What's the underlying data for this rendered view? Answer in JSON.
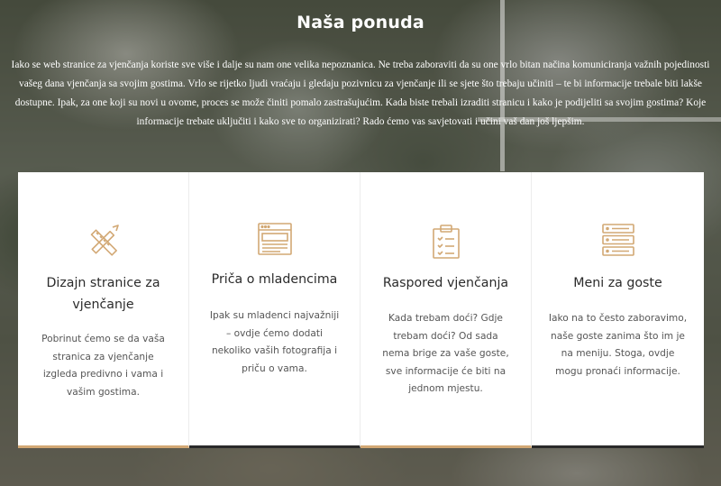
{
  "section": {
    "title": "Naša ponuda",
    "intro": "Iako se web stranice za vjenčanja koriste sve više i dalje su nam one velika nepoznanica. Ne treba zaboraviti da su one vrlo bitan načina komuniciranja važnih pojedinosti vašeg dana vjenčanja sa svojim gostima. Vrlo se rijetko ljudi vraćaju i gledaju pozivnicu za vjenčanje ili se sjete što trebaju učiniti – te bi informacije trebale biti lakše dostupne. Ipak, za one koji su novi u ovome, proces se može činiti pomalo zastrašujućim. Kada biste trebali izraditi stranicu i kako je podijeliti sa svojim gostima? Koje informacije trebate uključiti i kako sve to organizirati? Rado ćemo vas savjetovati i učini vaš dan još ljepšim."
  },
  "colors": {
    "accent": "#d2a874",
    "dark": "#2a2a2a",
    "card_bg": "#ffffff"
  },
  "cards": [
    {
      "icon": "design-tools-icon",
      "title": "Dizajn stranice za vjenčanje",
      "text": "Pobrinut ćemo se da vaša stranica za vjenčanje izgleda predivno i vama i vašim gostima."
    },
    {
      "icon": "browser-window-icon",
      "title": "Priča o mladencima",
      "text": "Ipak su mladenci najvažniji – ovdje ćemo dodati nekoliko vaših fotografija i priču o vama."
    },
    {
      "icon": "clipboard-checklist-icon",
      "title": "Raspored vjenčanja",
      "text": "Kada trebam doći? Gdje trebam doći? Od sada nema brige za vaše goste, sve informacije će biti na jednom mjestu."
    },
    {
      "icon": "server-list-icon",
      "title": "Meni za goste",
      "text": "Iako na to često zaboravimo, naše goste zanima što im je na meniju. Stoga, ovdje mogu pronaći informacije."
    }
  ]
}
